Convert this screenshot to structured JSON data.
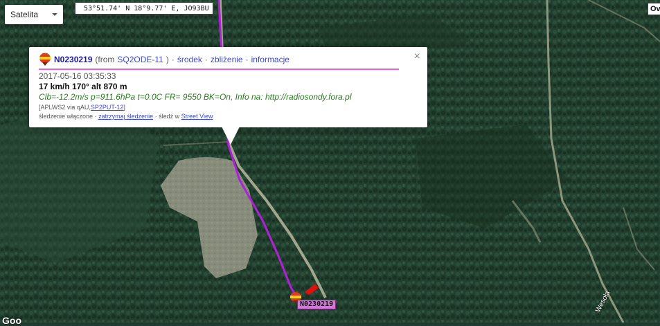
{
  "map": {
    "map_type_label": "Satelita",
    "coords_text": "53°51.74' N 18°9.77' E, JO93BU",
    "corner_button_label": "Ov",
    "road_label": "Wesoła",
    "attribution": "Goo",
    "track_color": "#b020d8",
    "balloon_label": "N0230219"
  },
  "popup": {
    "callsign": "N0230219",
    "from_text": "(from",
    "from_station": "SQ2ODE-11",
    "from_close": ")",
    "links": [
      "środek",
      "zbliżenie",
      "informacje"
    ],
    "separator": "·",
    "timestamp": "2017-05-16 03:35:33",
    "speed_line": "17 km/h 170° alt 870 m",
    "comment": "Clb=-12.2m/s p=911.6hPa t=0.0C FR= 9550 BK=On, Info na: http://radiosondy.fora.pl",
    "path_prefix": "[APLWS2 via qAU,",
    "path_station": "SP2PUT-12",
    "path_suffix": "]",
    "tracking_text": "śledzenie włączone ·",
    "stop_tracking_link": "zatrzymaj śledzenie",
    "mid_sep": "·",
    "streetview_prefix": "śledź w",
    "streetview_link": "Street View",
    "close_glyph": "×"
  }
}
